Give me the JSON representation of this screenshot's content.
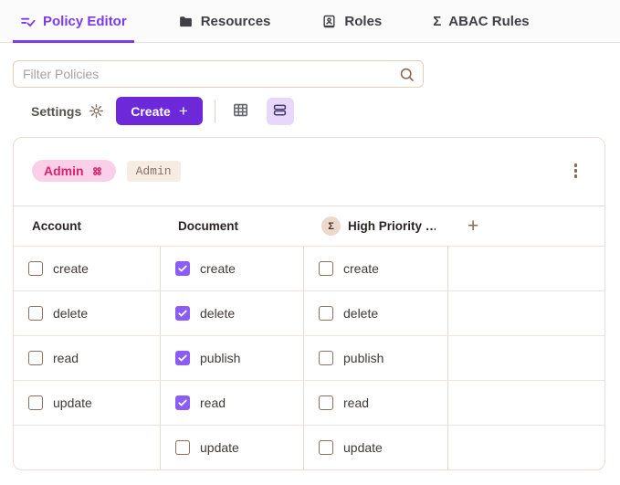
{
  "tabs": [
    {
      "label": "Policy Editor",
      "icon": "checklist-icon",
      "active": true
    },
    {
      "label": "Resources",
      "icon": "folder-icon",
      "active": false
    },
    {
      "label": "Roles",
      "icon": "contact-card-icon",
      "active": false
    },
    {
      "label": "ABAC Rules",
      "icon": "sigma-icon",
      "active": false
    }
  ],
  "icons": {
    "sigma": "Σ"
  },
  "filter": {
    "placeholder": "Filter Policies"
  },
  "toolbar": {
    "settings_label": "Settings",
    "create_label": "Create",
    "create_plus": "+"
  },
  "policy_card": {
    "role_pill": "Admin",
    "role_tag": "Admin",
    "table": {
      "headers": [
        "Account",
        "Document",
        "High Priority …"
      ],
      "add_column_label": "+",
      "rows": [
        [
          {
            "label": "create",
            "checked": false
          },
          {
            "label": "create",
            "checked": true
          },
          {
            "label": "create",
            "checked": false
          },
          null
        ],
        [
          {
            "label": "delete",
            "checked": false
          },
          {
            "label": "delete",
            "checked": true
          },
          {
            "label": "delete",
            "checked": false
          },
          null
        ],
        [
          {
            "label": "read",
            "checked": false
          },
          {
            "label": "publish",
            "checked": true
          },
          {
            "label": "publish",
            "checked": false
          },
          null
        ],
        [
          {
            "label": "update",
            "checked": false
          },
          {
            "label": "read",
            "checked": true
          },
          {
            "label": "read",
            "checked": false
          },
          null
        ],
        [
          null,
          {
            "label": "update",
            "checked": false
          },
          {
            "label": "update",
            "checked": false
          },
          null
        ]
      ]
    }
  },
  "colors": {
    "accent": "#7c3aed",
    "create_btn": "#6d28d9",
    "checkbox_checked": "#8b5cf6",
    "checkbox_border": "#8d6f60",
    "toggle_active_bg": "#e7d7fb",
    "toggle_active_icon": "#453a6e",
    "grid_icon": "#63636b",
    "pill_bg": "#fbcfe8",
    "pill_text": "#d6246f",
    "tag_bg": "#f6ece2",
    "tag_text": "#8a7264",
    "brown_icon": "#8a6a55",
    "gear_icon": "#7d6a5a",
    "settings_text": "#57534e",
    "input_border": "#e3d0bd",
    "placeholder": "#a8a29e",
    "card_border": "#f0dcd4",
    "row_border": "#f1e3db",
    "col_border": "#e2dbd7",
    "header_border": "#e7ddd7",
    "topbar_bg": "#fbfbfc",
    "topbar_border": "#e4e4e7",
    "tab_inactive": "#3f3f46",
    "text_dark": "#292524",
    "label_text": "#3f3a36",
    "toolbar_divider": "#ddd2c7",
    "sigma_bg": "#ecd9cc",
    "sigma_text": "#44342a"
  }
}
